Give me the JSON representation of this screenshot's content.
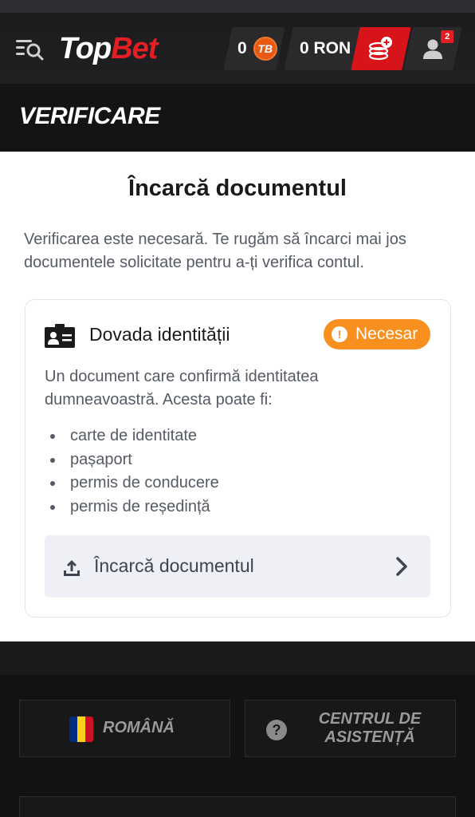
{
  "header": {
    "logo_top": "Top",
    "logo_bet": "Bet",
    "tb_balance": "0",
    "tb_coin_label": "TB",
    "ron_balance": "0 RON",
    "notifications_count": "2"
  },
  "page": {
    "title": "VERIFICARE"
  },
  "content": {
    "heading": "Încarcă documentul",
    "intro": "Verificarea este necesară. Te rugăm să încarci mai jos documentele solicitate pentru a-ți verifica contul.",
    "card": {
      "title": "Dovada identității",
      "status": "Necesar",
      "description": "Un document care confirmă identitatea dumneavoastră. Acesta poate fi:",
      "documents": [
        "carte de identitate",
        "pașaport",
        "permis de conducere",
        "permis de reședință"
      ],
      "upload_label": "Încarcă documentul"
    }
  },
  "footer": {
    "language_label": "ROMÂNĂ",
    "help_label": "CENTRUL DE ASISTENȚĂ"
  },
  "icons": {
    "menu": "menu-search-icon",
    "tb_coin": "tb-coin-icon",
    "deposit": "deposit-coins-icon",
    "user": "user-icon",
    "id_card": "id-card-icon",
    "alert": "exclamation-icon",
    "upload": "upload-icon",
    "chevron": "chevron-right-icon",
    "flag": "romania-flag-icon",
    "help": "question-icon"
  },
  "colors": {
    "brand_red": "#e31e24",
    "status_orange": "#f7901e",
    "tb_orange": "#e85a12"
  }
}
